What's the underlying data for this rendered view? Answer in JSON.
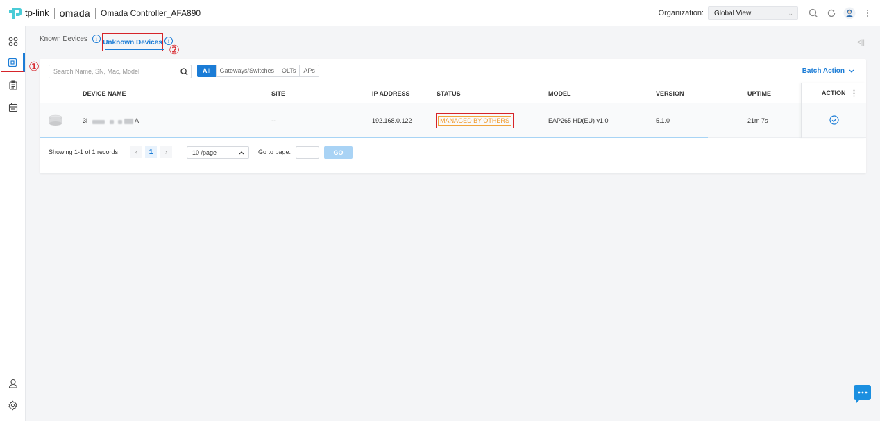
{
  "header": {
    "brand_tp": "tp-link",
    "brand_omada": "omada",
    "controller_name": "Omada Controller_AFA890",
    "org_label": "Organization:",
    "org_value": "Global View"
  },
  "annotations": {
    "marker_1": "①",
    "marker_2": "②"
  },
  "tabs": {
    "known": "Known Devices",
    "unknown": "Unknown Devices"
  },
  "toolbar": {
    "search_placeholder": "Search Name, SN, Mac, Model",
    "filters": [
      "All",
      "Gateways/Switches",
      "OLTs",
      "APs"
    ],
    "batch_action": "Batch Action"
  },
  "table": {
    "columns": {
      "device_name": "DEVICE NAME",
      "site": "SITE",
      "ip": "IP ADDRESS",
      "status": "STATUS",
      "model": "MODEL",
      "version": "VERSION",
      "uptime": "UPTIME",
      "action": "ACTION"
    },
    "rows": [
      {
        "name_prefix": "3l",
        "name_suffix": "A",
        "site": "--",
        "ip": "192.168.0.122",
        "status": "MANAGED BY OTHERS",
        "model": "EAP265 HD(EU) v1.0",
        "version": "5.1.0",
        "uptime": "21m 7s"
      }
    ]
  },
  "pagination": {
    "summary": "Showing 1-1 of 1 records",
    "current_page": "1",
    "page_size": "10 /page",
    "goto_label": "Go to page:",
    "go": "GO"
  },
  "colors": {
    "accent": "#1b7cd6",
    "annotation_red": "#d6242a",
    "status_orange": "#f19a2b"
  }
}
